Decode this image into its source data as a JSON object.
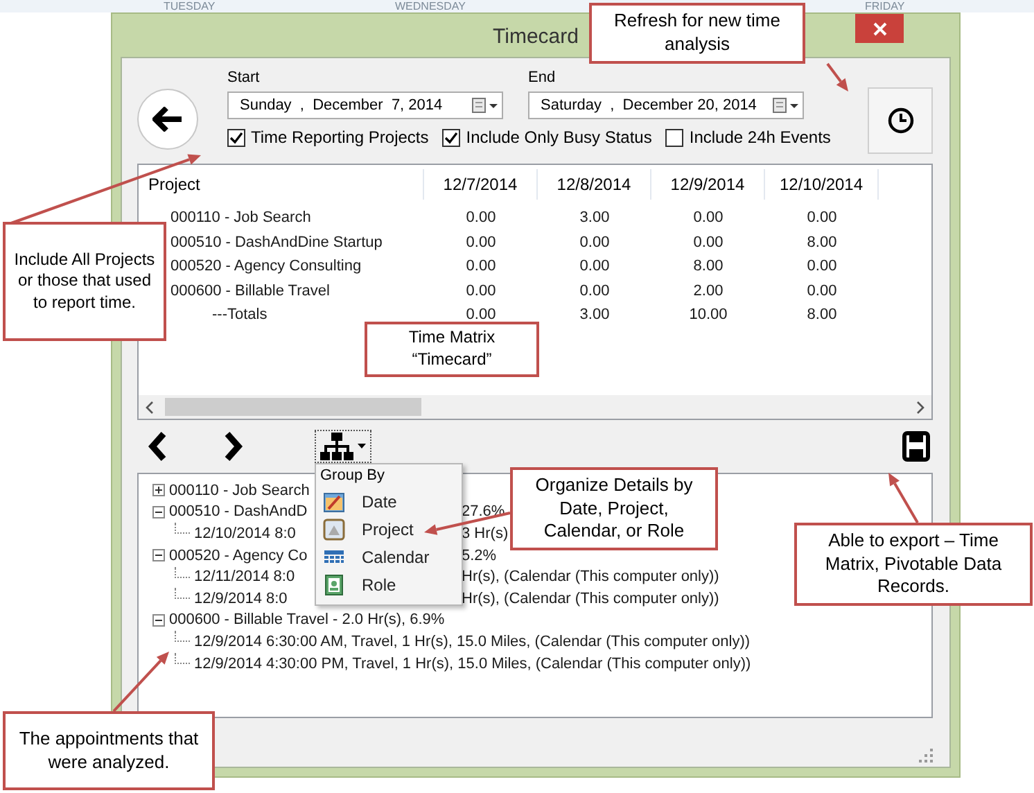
{
  "background": {
    "day_headers": [
      "TUESDAY",
      "WEDNESDAY",
      "FRIDAY"
    ]
  },
  "window": {
    "title": "Timecard"
  },
  "range": [
    {
      "label": "Start",
      "value": "Sunday  ,  December  7, 2014"
    },
    {
      "label": "End",
      "value": "Saturday  ,  December 20, 2014"
    }
  ],
  "options": [
    {
      "label": "Time Reporting Projects",
      "checked": true
    },
    {
      "label": "Include Only Busy Status",
      "checked": true
    },
    {
      "label": "Include 24h Events",
      "checked": false
    }
  ],
  "matrix": {
    "columns": [
      "Project",
      "12/7/2014",
      "12/8/2014",
      "12/9/2014",
      "12/10/2014"
    ],
    "rows": [
      {
        "kind": "project",
        "name": "000110 - Job Search",
        "values": [
          "0.00",
          "3.00",
          "0.00",
          "0.00"
        ]
      },
      {
        "kind": "project",
        "name": "000510 - DashAndDine Startup",
        "values": [
          "0.00",
          "0.00",
          "0.00",
          "8.00"
        ]
      },
      {
        "kind": "project",
        "name": "000520 - Agency Consulting",
        "values": [
          "0.00",
          "0.00",
          "8.00",
          "0.00"
        ]
      },
      {
        "kind": "project",
        "name": "000600 - Billable Travel",
        "values": [
          "0.00",
          "0.00",
          "2.00",
          "0.00"
        ]
      },
      {
        "kind": "total",
        "name": "---Totals",
        "values": [
          "0.00",
          "3.00",
          "10.00",
          "8.00"
        ]
      }
    ]
  },
  "details": {
    "tree": [
      {
        "text": "000110 - Job Search",
        "expanded": false
      },
      {
        "text": "000510 - DashAndD",
        "tail": "27.6%",
        "expanded": true,
        "children": [
          {
            "text": "12/10/2014 8:0",
            "tail": "3 Hr(s)"
          }
        ]
      },
      {
        "text": "000520 - Agency Co",
        "tail": "5.2%",
        "expanded": true,
        "children": [
          {
            "text": "12/11/2014 8:0",
            "tail": "Hr(s), (Calendar (This computer only))"
          },
          {
            "text": "12/9/2014 8:0",
            "tail": "Hr(s), (Calendar (This computer only))"
          }
        ]
      },
      {
        "text": "000600 - Billable Travel - 2.0 Hr(s), 6.9%",
        "expanded": true,
        "children": [
          {
            "text": "12/9/2014 6:30:00 AM, Travel, 1 Hr(s), 15.0 Miles, (Calendar (This computer only))"
          },
          {
            "text": "12/9/2014 4:30:00 PM, Travel, 1 Hr(s), 15.0 Miles, (Calendar (This computer only))"
          }
        ]
      }
    ]
  },
  "group_menu": {
    "title": "Group By",
    "items": [
      {
        "kind": "date",
        "label": "Date"
      },
      {
        "kind": "project",
        "label": "Project"
      },
      {
        "kind": "calendar",
        "label": "Calendar"
      },
      {
        "kind": "role",
        "label": "Role"
      }
    ]
  },
  "callouts": [
    {
      "text": "Refresh for new time analysis"
    },
    {
      "text": "Include All Projects or those that used to report time."
    },
    {
      "text": "Time Matrix “Timecard”"
    },
    {
      "text": "Organize Details by Date, Project, Calendar, or Role"
    },
    {
      "text": "Able to export – Time Matrix, Pivotable Data Records."
    },
    {
      "text": "The appointments that were analyzed."
    }
  ]
}
